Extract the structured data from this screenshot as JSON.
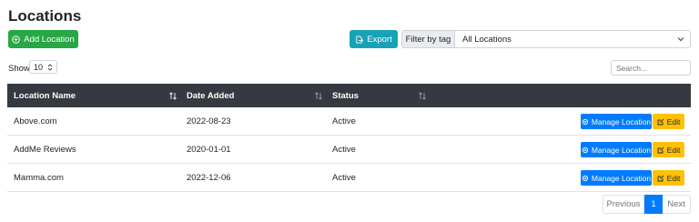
{
  "page": {
    "title": "Locations"
  },
  "toolbar": {
    "add_label": "Add Location",
    "export_label": "Export",
    "filter_label": "Filter by tag",
    "filter_value": "All Locations"
  },
  "table_controls": {
    "show_label": "Show",
    "show_value": "10",
    "search_placeholder": "Search..."
  },
  "table": {
    "headers": [
      "Location Name",
      "Date Added",
      "Status"
    ],
    "rows": [
      {
        "name": "Above.com",
        "date": "2022-08-23",
        "status": "Active"
      },
      {
        "name": "AddMe Reviews",
        "date": "2020-01-01",
        "status": "Active"
      },
      {
        "name": "Mamma.com",
        "date": "2022-12-06",
        "status": "Active"
      }
    ],
    "manage_label": "Manage Location",
    "edit_label": "Edit"
  },
  "pagination": {
    "previous": "Previous",
    "current": "1",
    "next": "Next"
  },
  "colors": {
    "add_button": "#28a745",
    "export_button": "#17a2b8",
    "header_bg": "#343a40",
    "manage_button": "#007bff",
    "edit_button": "#ffc107"
  },
  "icons": {
    "add": "plus-circle-icon",
    "export": "export-icon",
    "manage": "gear-icon",
    "edit": "edit-icon",
    "sort": "sort-icon",
    "select": "chevron-down-icon"
  }
}
